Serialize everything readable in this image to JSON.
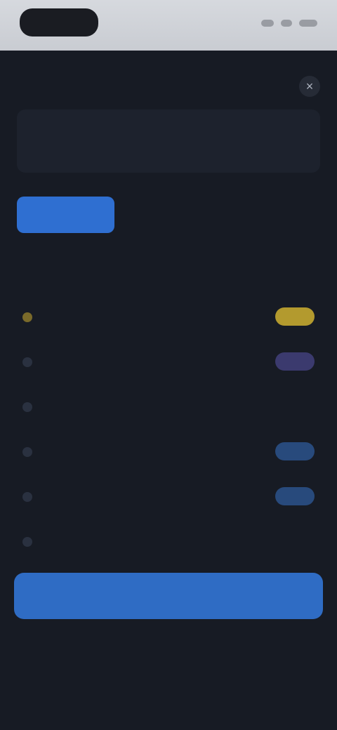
{
  "intro": {
    "text": ""
  },
  "header": {
    "title": "",
    "close_glyph": "×"
  },
  "tabs": [
    {
      "label": ""
    },
    {
      "label": ""
    },
    {
      "label": ""
    }
  ],
  "section": {
    "link": "",
    "sub": ""
  },
  "items": [
    {
      "name": "",
      "desc": "",
      "badge": ""
    },
    {
      "name": "",
      "desc": "",
      "badge": ""
    },
    {
      "name": "",
      "desc": "",
      "badge": ""
    },
    {
      "name": "",
      "desc": "",
      "badge": ""
    },
    {
      "name": "",
      "desc": "",
      "badge": ""
    },
    {
      "name": "",
      "desc": ""
    }
  ],
  "actions": {
    "primary": "",
    "secondary": ""
  },
  "footnote": "",
  "colors": {
    "accent": "#2f6cc4",
    "badge_gold": "#b39a2e",
    "badge_purple": "#3b3a6e",
    "badge_blue": "#284a7c",
    "background": "#171b24"
  }
}
